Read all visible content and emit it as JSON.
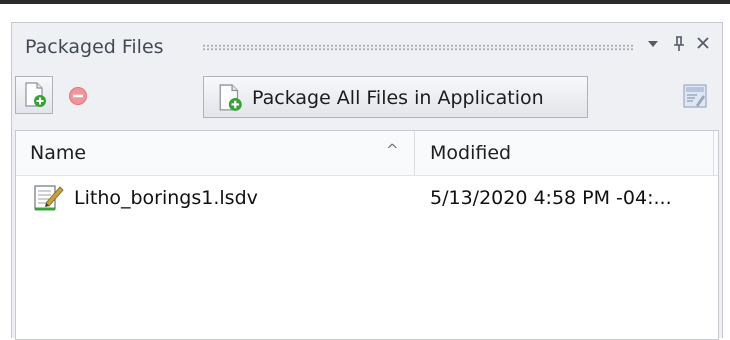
{
  "panel": {
    "title": "Packaged Files",
    "dropdown_glyph": "▾",
    "pin_glyph": "ꟾ",
    "close_glyph": "✕"
  },
  "toolbar": {
    "add_icon": "add-file-icon",
    "remove_icon": "remove-icon",
    "package_all_label": "Package All Files in Application",
    "properties_icon": "properties-icon"
  },
  "columns": {
    "name": "Name",
    "sort_indicator": "^",
    "modified": "Modified"
  },
  "files": [
    {
      "name": "Litho_borings1.lsdv",
      "modified": "5/13/2020 4:58 PM -04:...",
      "icon": "document-edit-icon"
    }
  ],
  "colors": {
    "accent_green": "#3aa03a",
    "remove_red": "#e8757a",
    "panel_bg": "#eef0f4"
  }
}
